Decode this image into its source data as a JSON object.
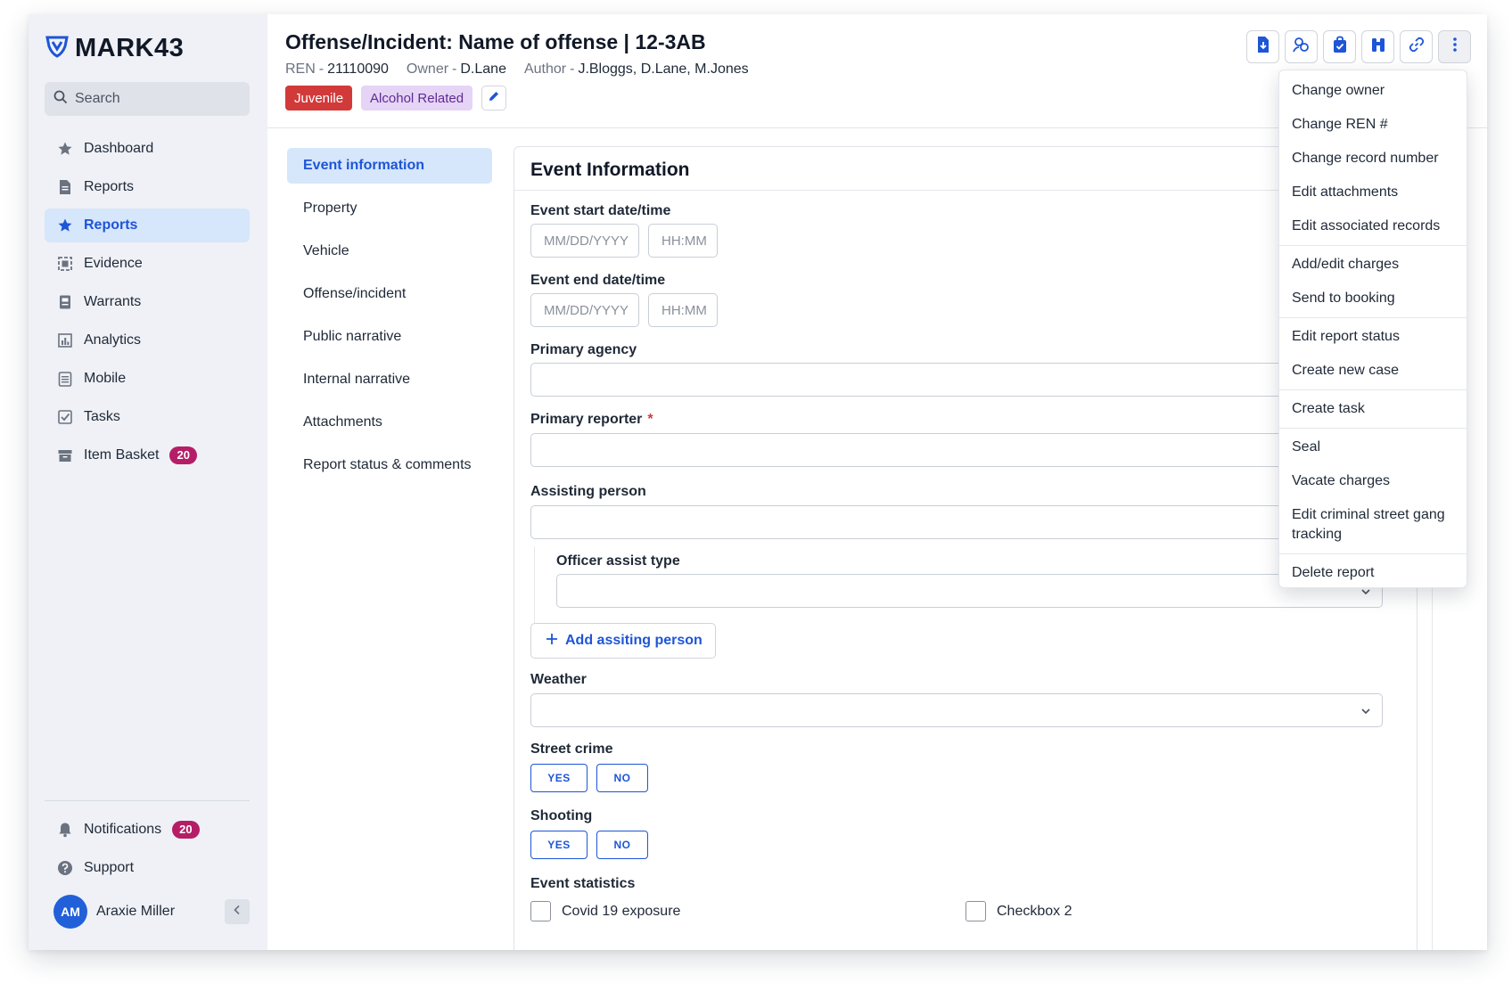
{
  "app": {
    "logo_text": "MARK43"
  },
  "search": {
    "placeholder": "Search"
  },
  "sidebar": {
    "items": [
      {
        "label": "Dashboard"
      },
      {
        "label": "Reports"
      },
      {
        "label": "Reports",
        "active": true
      },
      {
        "label": "Evidence"
      },
      {
        "label": "Warrants"
      },
      {
        "label": "Analytics"
      },
      {
        "label": "Mobile"
      },
      {
        "label": "Tasks"
      },
      {
        "label": "Item Basket",
        "badge": "20"
      }
    ],
    "bottom": [
      {
        "label": "Notifications",
        "badge": "20"
      },
      {
        "label": "Support"
      }
    ],
    "user": {
      "initials": "AM",
      "name": "Araxie Miller"
    }
  },
  "header": {
    "title": "Offense/Incident: Name of offense | 12-3AB",
    "meta": [
      {
        "key": "REN",
        "value": "21110090"
      },
      {
        "key": "Owner",
        "value": "D.Lane"
      },
      {
        "key": "Author",
        "value": "J.Bloggs, D.Lane, M.Jones"
      }
    ],
    "meta_dash": "-",
    "tags": [
      {
        "label": "Juvenile",
        "color": "#d23a3a"
      },
      {
        "label": "Alcohol Related",
        "color": "#e6d4f7"
      }
    ]
  },
  "toolbar_icons": [
    "export-pdf-icon",
    "link-persons-icon",
    "evidence-bag-icon",
    "binoculars-icon",
    "link-icon",
    "more-vertical-icon"
  ],
  "section_nav": [
    {
      "label": "Event information",
      "active": true
    },
    {
      "label": "Property"
    },
    {
      "label": "Vehicle"
    },
    {
      "label": "Offense/incident"
    },
    {
      "label": "Public narrative"
    },
    {
      "label": "Internal narrative"
    },
    {
      "label": "Attachments"
    },
    {
      "label": "Report status & comments"
    }
  ],
  "form": {
    "title": "Event Information",
    "event_start": {
      "label": "Event start date/time",
      "date_placeholder": "MM/DD/YYYY",
      "time_placeholder": "HH:MM"
    },
    "event_end": {
      "label": "Event end date/time",
      "date_placeholder": "MM/DD/YYYY",
      "time_placeholder": "HH:MM"
    },
    "primary_agency": {
      "label": "Primary agency",
      "value": ""
    },
    "primary_reporter": {
      "label": "Primary reporter",
      "required_mark": "*",
      "value": ""
    },
    "assisting_person": {
      "label": "Assisting person",
      "value": ""
    },
    "officer_assist_type": {
      "label": "Officer assist type",
      "value": ""
    },
    "add_button": "Add assiting person",
    "weather": {
      "label": "Weather",
      "value": ""
    },
    "street_crime": {
      "label": "Street crime",
      "yes": "YES",
      "no": "NO"
    },
    "shooting": {
      "label": "Shooting",
      "yes": "YES",
      "no": "NO"
    },
    "event_statistics": {
      "label": "Event statistics",
      "checkboxes": [
        {
          "label": "Covid 19 exposure",
          "checked": false
        },
        {
          "label": "Checkbox 2",
          "checked": false
        }
      ]
    }
  },
  "menu": {
    "groups": [
      [
        "Change owner",
        "Change REN #",
        "Change record number",
        "Edit attachments",
        "Edit associated records"
      ],
      [
        "Add/edit charges",
        "Send to booking"
      ],
      [
        "Edit report status",
        "Create new case"
      ],
      [
        "Create task"
      ],
      [
        "Seal",
        "Vacate charges",
        "Edit criminal street gang tracking"
      ],
      [
        "Delete report"
      ]
    ]
  },
  "colors": {
    "accent": "#1e55d6",
    "active_bg": "#d6e6fb",
    "badge": "#b51e66",
    "danger": "#d23a3a"
  }
}
